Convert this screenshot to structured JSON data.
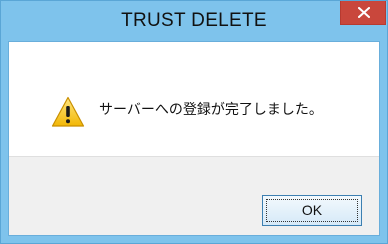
{
  "window": {
    "title": "TRUST DELETE",
    "close_icon": "close-icon",
    "accent_color": "#7ec3ec",
    "close_color": "#c9473c"
  },
  "dialog": {
    "icon": "warning-icon",
    "message": "サーバーへの登録が完了しました。",
    "ok_label": "OK"
  }
}
